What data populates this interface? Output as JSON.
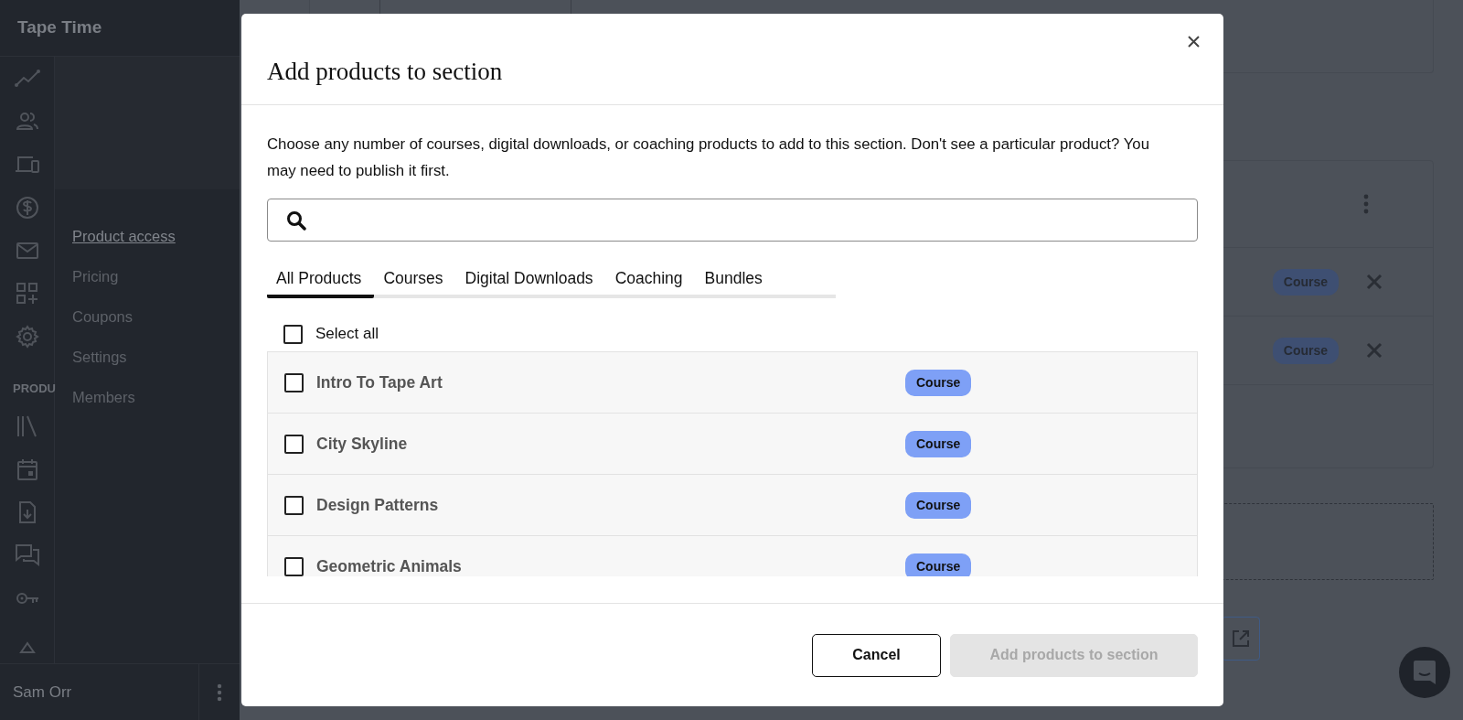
{
  "app": {
    "brand": "Tape Time",
    "section_label": "PRODU",
    "user": "Sam Orr"
  },
  "subnav": [
    {
      "label": "Product access",
      "selected": true
    },
    {
      "label": "Pricing",
      "selected": false
    },
    {
      "label": "Coupons",
      "selected": false
    },
    {
      "label": "Settings",
      "selected": false
    },
    {
      "label": "Members",
      "selected": false
    }
  ],
  "background_rows": [
    {
      "badge": "Course"
    },
    {
      "badge": "Course"
    }
  ],
  "modal": {
    "title": "Add products to section",
    "description": "Choose any number of courses, digital downloads, or coaching products to add to this section. Don't see a particular product? You may need to publish it first.",
    "tabs": [
      {
        "label": "All Products",
        "selected": true
      },
      {
        "label": "Courses",
        "selected": false
      },
      {
        "label": "Digital Downloads",
        "selected": false
      },
      {
        "label": "Coaching",
        "selected": false
      },
      {
        "label": "Bundles",
        "selected": false
      }
    ],
    "select_all": {
      "label": "Select all",
      "checked": false
    },
    "products": [
      {
        "name": "Intro To Tape Art",
        "badge": "Course",
        "checked": false
      },
      {
        "name": "City Skyline",
        "badge": "Course",
        "checked": false
      },
      {
        "name": "Design Patterns",
        "badge": "Course",
        "checked": false
      },
      {
        "name": "Geometric Animals",
        "badge": "Course",
        "checked": false
      }
    ],
    "buttons": [
      {
        "label": "Cancel",
        "kind": "secondary",
        "disabled": false
      },
      {
        "label": "Add products to section",
        "kind": "primary",
        "disabled": true
      }
    ]
  }
}
